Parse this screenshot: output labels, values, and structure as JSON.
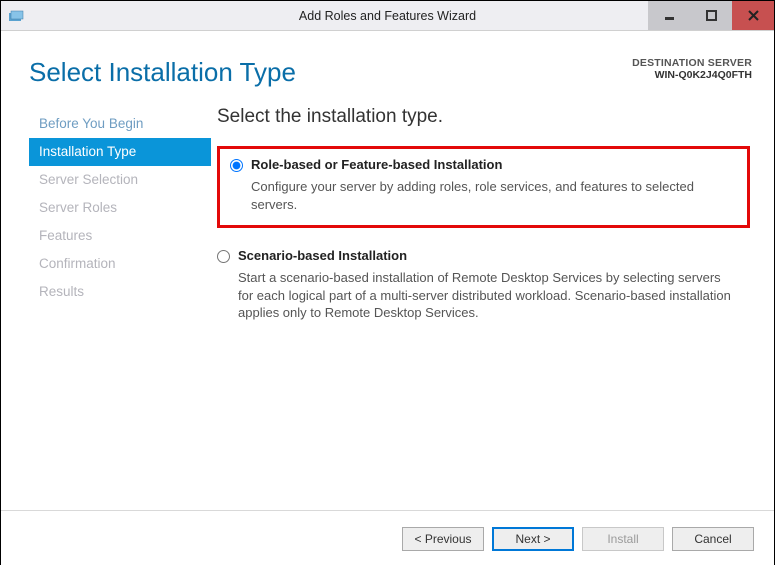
{
  "window": {
    "title": "Add Roles and Features Wizard"
  },
  "header": {
    "page_title": "Select Installation Type",
    "destination_label": "DESTINATION SERVER",
    "destination_name": "WIN-Q0K2J4Q0FTH"
  },
  "sidebar": {
    "items": [
      {
        "label": "Before You Begin"
      },
      {
        "label": "Installation Type"
      },
      {
        "label": "Server Selection"
      },
      {
        "label": "Server Roles"
      },
      {
        "label": "Features"
      },
      {
        "label": "Confirmation"
      },
      {
        "label": "Results"
      }
    ]
  },
  "main": {
    "heading": "Select the installation type.",
    "option1": {
      "title": "Role-based or Feature-based Installation",
      "desc": "Configure your server by adding roles, role services, and features to selected servers."
    },
    "option2": {
      "title": "Scenario-based Installation",
      "desc": "Start a scenario-based installation of Remote Desktop Services by selecting servers for each logical part of a multi-server distributed workload. Scenario-based installation applies only to Remote Desktop Services."
    }
  },
  "footer": {
    "previous": "< Previous",
    "next": "Next >",
    "install": "Install",
    "cancel": "Cancel"
  }
}
